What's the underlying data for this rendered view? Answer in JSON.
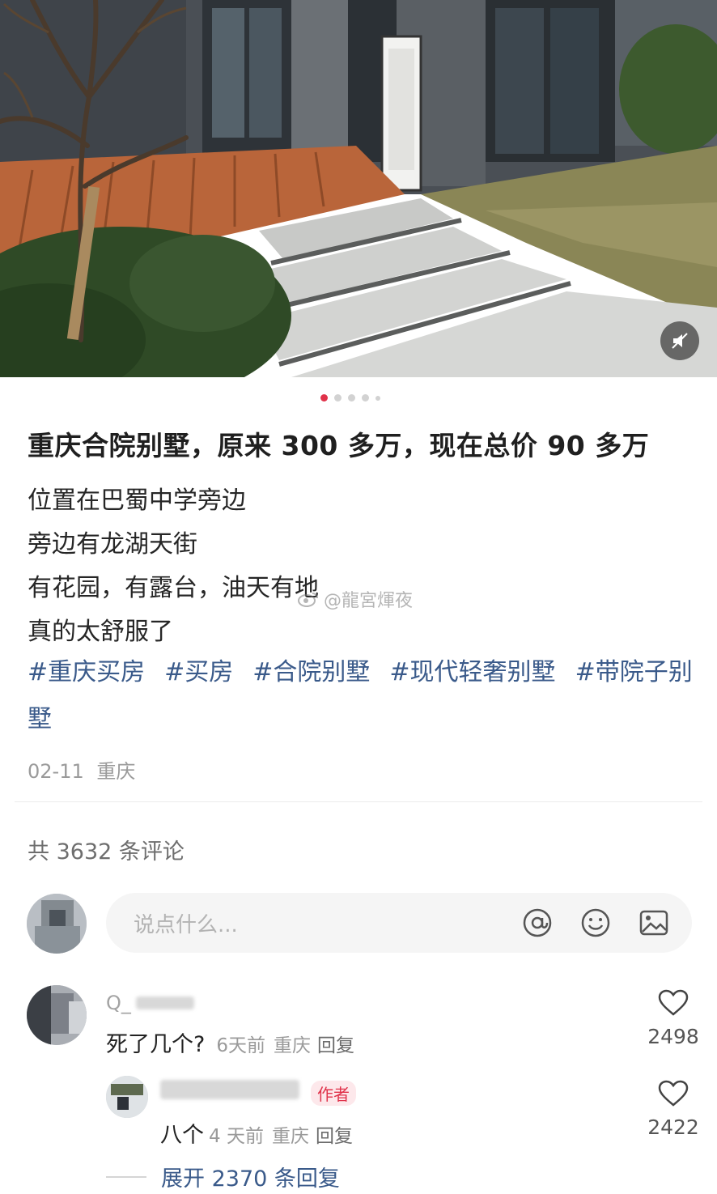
{
  "hero": {
    "mute_icon": "speaker-mute-icon"
  },
  "carousel": {
    "total_dots": 5,
    "active_index": 0
  },
  "post": {
    "title": "重庆合院别墅，原来 300 多万，现在总价 90 多万",
    "lines": [
      "位置在巴蜀中学旁边",
      "旁边有龙湖天街",
      "有花园，有露台，油天有地",
      "真的太舒服了"
    ],
    "tags": [
      "#重庆买房",
      "#买房",
      "#合院别墅",
      "#现代轻奢别墅",
      "#带院子别墅"
    ],
    "date": "02-11",
    "location": "重庆"
  },
  "watermark": {
    "text": "@龍宮煇夜",
    "icon": "weibo-logo"
  },
  "comments_header": {
    "text": "共 3632 条评论"
  },
  "comment_input": {
    "placeholder": "说点什么...",
    "icons": [
      "at-icon",
      "emoji-icon",
      "image-icon"
    ]
  },
  "comments": [
    {
      "username": "Q_",
      "text": "死了几个?",
      "time": "6天前",
      "location": "重庆",
      "reply_label": "回复",
      "likes": "2498"
    }
  ],
  "replies": [
    {
      "author_badge": "作者",
      "text": "八个",
      "time": "4 天前",
      "location": "重庆",
      "reply_label": "回复",
      "likes": "2422"
    }
  ],
  "expand": {
    "label": "展开 2370 条回复"
  },
  "colors": {
    "accent": "#e0324a",
    "tag": "#3a5a8a"
  }
}
